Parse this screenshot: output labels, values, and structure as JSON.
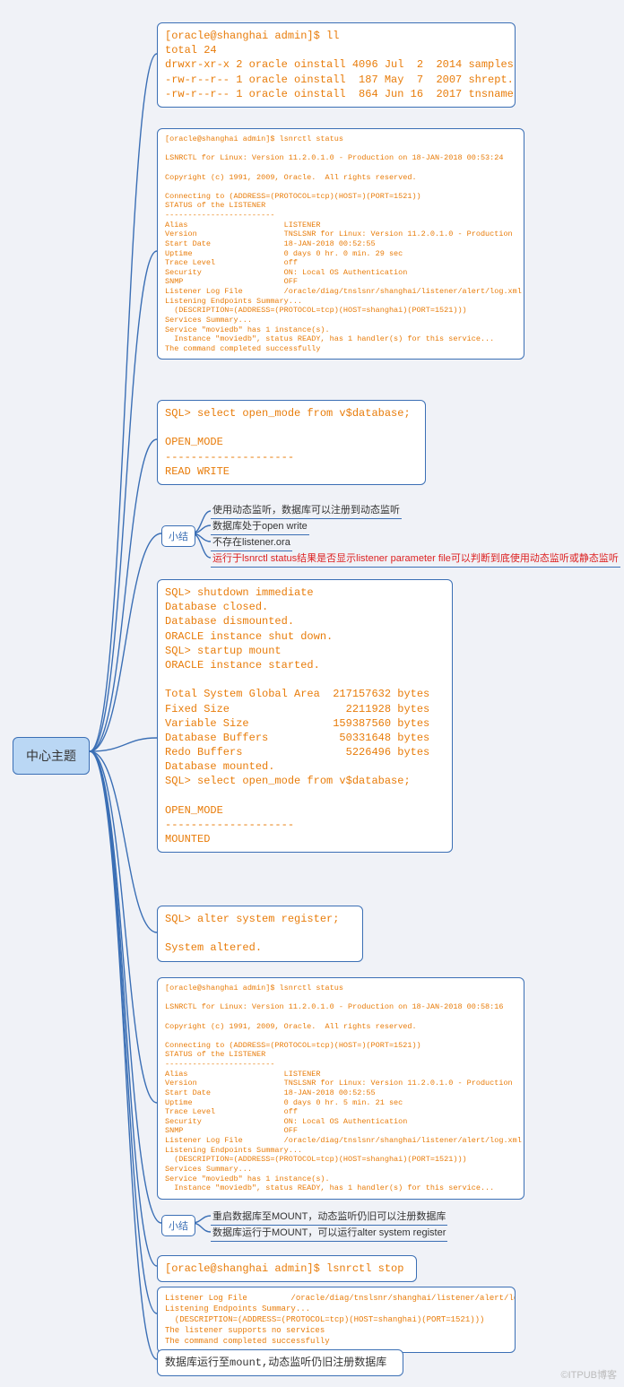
{
  "root": {
    "label": "中心主题"
  },
  "watermark": "©ITPUB博客",
  "block1": {
    "text": "[oracle@shanghai admin]$ ll\ntotal 24\ndrwxr-xr-x 2 oracle oinstall 4096 Jul  2  2014 samples\n-rw-r--r-- 1 oracle oinstall  187 May  7  2007 shrept.lst\n-rw-r--r-- 1 oracle oinstall  864 Jun 16  2017 tnsnames.ora"
  },
  "block2": {
    "text": "[oracle@shanghai admin]$ lsnrctl status\n\nLSNRCTL for Linux: Version 11.2.0.1.0 - Production on 18-JAN-2018 00:53:24\n\nCopyright (c) 1991, 2009, Oracle.  All rights reserved.\n\nConnecting to (ADDRESS=(PROTOCOL=tcp)(HOST=)(PORT=1521))\nSTATUS of the LISTENER\n------------------------\nAlias                     LISTENER\nVersion                   TNSLSNR for Linux: Version 11.2.0.1.0 - Production\nStart Date                18-JAN-2018 00:52:55\nUptime                    0 days 0 hr. 0 min. 29 sec\nTrace Level               off\nSecurity                  ON: Local OS Authentication\nSNMP                      OFF\nListener Log File         /oracle/diag/tnslsnr/shanghai/listener/alert/log.xml\nListening Endpoints Summary...\n  (DESCRIPTION=(ADDRESS=(PROTOCOL=tcp)(HOST=shanghai)(PORT=1521)))\nServices Summary...\nService \"moviedb\" has 1 instance(s).\n  Instance \"moviedb\", status READY, has 1 handler(s) for this service...\nThe command completed successfully"
  },
  "block3": {
    "text": "SQL> select open_mode from v$database;\n\nOPEN_MODE\n--------------------\nREAD WRITE"
  },
  "summary1": {
    "label": "小结",
    "items": [
      {
        "text": "使用动态监听，数据库可以注册到动态监听",
        "red": false
      },
      {
        "text": "数据库处于open write",
        "red": false
      },
      {
        "text": "不存在listener.ora",
        "red": false
      },
      {
        "text": "运行于lsnrctl status结果是否显示listener parameter file可以判断到底使用动态监听或静态监听",
        "red": true
      }
    ]
  },
  "block4": {
    "text": "SQL> shutdown immediate\nDatabase closed.\nDatabase dismounted.\nORACLE instance shut down.\nSQL> startup mount\nORACLE instance started.\n\nTotal System Global Area  217157632 bytes\nFixed Size                  2211928 bytes\nVariable Size             159387560 bytes\nDatabase Buffers           50331648 bytes\nRedo Buffers                5226496 bytes\nDatabase mounted.\nSQL> select open_mode from v$database;\n\nOPEN_MODE\n--------------------\nMOUNTED"
  },
  "block5": {
    "text": "SQL> alter system register;\n\nSystem altered."
  },
  "block6": {
    "text": "[oracle@shanghai admin]$ lsnrctl status\n\nLSNRCTL for Linux: Version 11.2.0.1.0 - Production on 18-JAN-2018 00:58:16\n\nCopyright (c) 1991, 2009, Oracle.  All rights reserved.\n\nConnecting to (ADDRESS=(PROTOCOL=tcp)(HOST=)(PORT=1521))\nSTATUS of the LISTENER\n------------------------\nAlias                     LISTENER\nVersion                   TNSLSNR for Linux: Version 11.2.0.1.0 - Production\nStart Date                18-JAN-2018 00:52:55\nUptime                    0 days 0 hr. 5 min. 21 sec\nTrace Level               off\nSecurity                  ON: Local OS Authentication\nSNMP                      OFF\nListener Log File         /oracle/diag/tnslsnr/shanghai/listener/alert/log.xml\nListening Endpoints Summary...\n  (DESCRIPTION=(ADDRESS=(PROTOCOL=tcp)(HOST=shanghai)(PORT=1521)))\nServices Summary...\nService \"moviedb\" has 1 instance(s).\n  Instance \"moviedb\", status READY, has 1 handler(s) for this service..."
  },
  "summary2": {
    "label": "小结",
    "items": [
      {
        "text": "重启数据库至MOUNT，动态监听仍旧可以注册数据库",
        "red": false
      },
      {
        "text": "数据库运行于MOUNT，可以运行alter system register",
        "red": false
      }
    ]
  },
  "block7": {
    "text": "[oracle@shanghai admin]$ lsnrctl stop"
  },
  "block8": {
    "text": "Listener Log File         /oracle/diag/tnslsnr/shanghai/listener/alert/lc\nListening Endpoints Summary...\n  (DESCRIPTION=(ADDRESS=(PROTOCOL=tcp)(HOST=shanghai)(PORT=1521)))\nThe listener supports no services\nThe command completed successfully"
  },
  "block9": {
    "text": "数据库运行至mount,动态监听仍旧注册数据库"
  }
}
